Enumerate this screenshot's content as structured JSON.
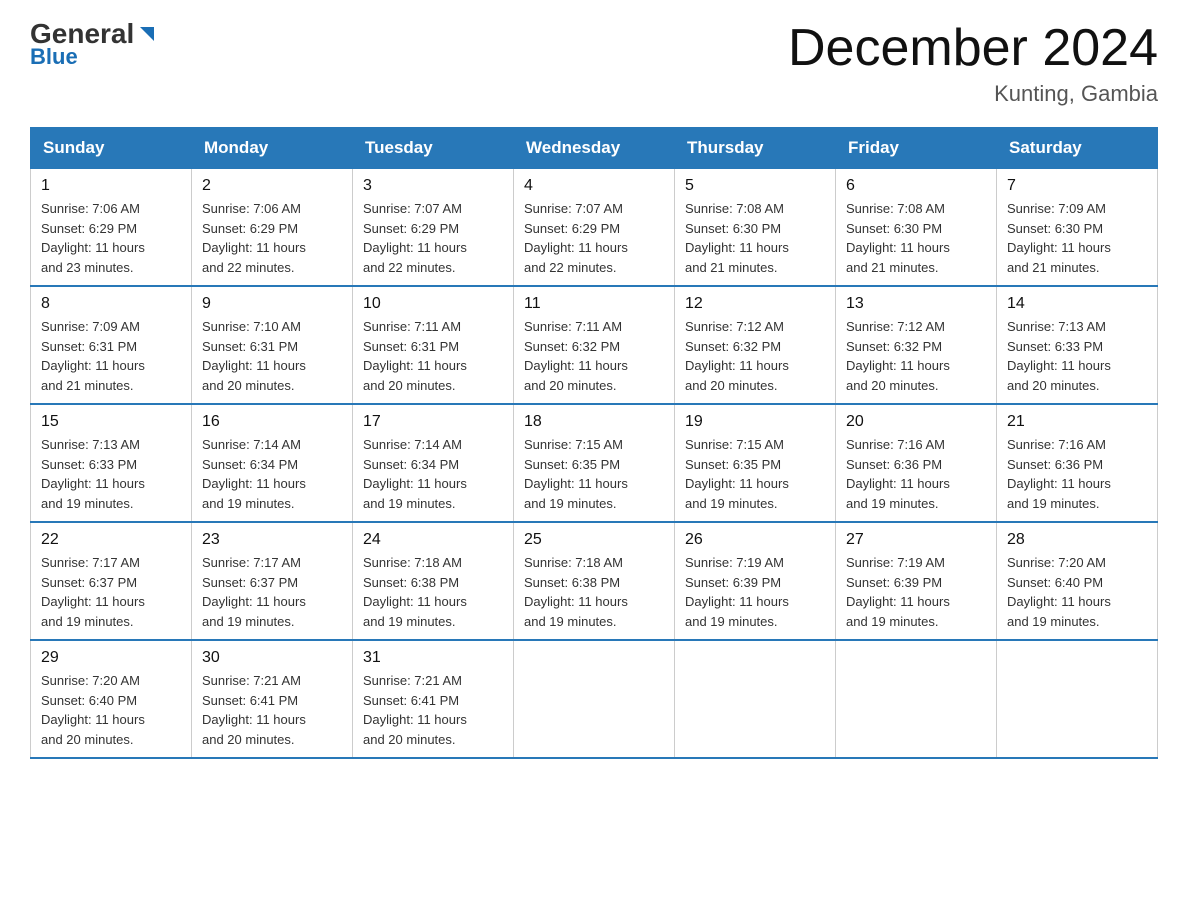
{
  "logo": {
    "text_general": "General",
    "text_blue": "Blue"
  },
  "title": "December 2024",
  "location": "Kunting, Gambia",
  "days_of_week": [
    "Sunday",
    "Monday",
    "Tuesday",
    "Wednesday",
    "Thursday",
    "Friday",
    "Saturday"
  ],
  "weeks": [
    [
      {
        "day": "1",
        "sunrise": "7:06 AM",
        "sunset": "6:29 PM",
        "daylight": "11 hours and 23 minutes."
      },
      {
        "day": "2",
        "sunrise": "7:06 AM",
        "sunset": "6:29 PM",
        "daylight": "11 hours and 22 minutes."
      },
      {
        "day": "3",
        "sunrise": "7:07 AM",
        "sunset": "6:29 PM",
        "daylight": "11 hours and 22 minutes."
      },
      {
        "day": "4",
        "sunrise": "7:07 AM",
        "sunset": "6:29 PM",
        "daylight": "11 hours and 22 minutes."
      },
      {
        "day": "5",
        "sunrise": "7:08 AM",
        "sunset": "6:30 PM",
        "daylight": "11 hours and 21 minutes."
      },
      {
        "day": "6",
        "sunrise": "7:08 AM",
        "sunset": "6:30 PM",
        "daylight": "11 hours and 21 minutes."
      },
      {
        "day": "7",
        "sunrise": "7:09 AM",
        "sunset": "6:30 PM",
        "daylight": "11 hours and 21 minutes."
      }
    ],
    [
      {
        "day": "8",
        "sunrise": "7:09 AM",
        "sunset": "6:31 PM",
        "daylight": "11 hours and 21 minutes."
      },
      {
        "day": "9",
        "sunrise": "7:10 AM",
        "sunset": "6:31 PM",
        "daylight": "11 hours and 20 minutes."
      },
      {
        "day": "10",
        "sunrise": "7:11 AM",
        "sunset": "6:31 PM",
        "daylight": "11 hours and 20 minutes."
      },
      {
        "day": "11",
        "sunrise": "7:11 AM",
        "sunset": "6:32 PM",
        "daylight": "11 hours and 20 minutes."
      },
      {
        "day": "12",
        "sunrise": "7:12 AM",
        "sunset": "6:32 PM",
        "daylight": "11 hours and 20 minutes."
      },
      {
        "day": "13",
        "sunrise": "7:12 AM",
        "sunset": "6:32 PM",
        "daylight": "11 hours and 20 minutes."
      },
      {
        "day": "14",
        "sunrise": "7:13 AM",
        "sunset": "6:33 PM",
        "daylight": "11 hours and 20 minutes."
      }
    ],
    [
      {
        "day": "15",
        "sunrise": "7:13 AM",
        "sunset": "6:33 PM",
        "daylight": "11 hours and 19 minutes."
      },
      {
        "day": "16",
        "sunrise": "7:14 AM",
        "sunset": "6:34 PM",
        "daylight": "11 hours and 19 minutes."
      },
      {
        "day": "17",
        "sunrise": "7:14 AM",
        "sunset": "6:34 PM",
        "daylight": "11 hours and 19 minutes."
      },
      {
        "day": "18",
        "sunrise": "7:15 AM",
        "sunset": "6:35 PM",
        "daylight": "11 hours and 19 minutes."
      },
      {
        "day": "19",
        "sunrise": "7:15 AM",
        "sunset": "6:35 PM",
        "daylight": "11 hours and 19 minutes."
      },
      {
        "day": "20",
        "sunrise": "7:16 AM",
        "sunset": "6:36 PM",
        "daylight": "11 hours and 19 minutes."
      },
      {
        "day": "21",
        "sunrise": "7:16 AM",
        "sunset": "6:36 PM",
        "daylight": "11 hours and 19 minutes."
      }
    ],
    [
      {
        "day": "22",
        "sunrise": "7:17 AM",
        "sunset": "6:37 PM",
        "daylight": "11 hours and 19 minutes."
      },
      {
        "day": "23",
        "sunrise": "7:17 AM",
        "sunset": "6:37 PM",
        "daylight": "11 hours and 19 minutes."
      },
      {
        "day": "24",
        "sunrise": "7:18 AM",
        "sunset": "6:38 PM",
        "daylight": "11 hours and 19 minutes."
      },
      {
        "day": "25",
        "sunrise": "7:18 AM",
        "sunset": "6:38 PM",
        "daylight": "11 hours and 19 minutes."
      },
      {
        "day": "26",
        "sunrise": "7:19 AM",
        "sunset": "6:39 PM",
        "daylight": "11 hours and 19 minutes."
      },
      {
        "day": "27",
        "sunrise": "7:19 AM",
        "sunset": "6:39 PM",
        "daylight": "11 hours and 19 minutes."
      },
      {
        "day": "28",
        "sunrise": "7:20 AM",
        "sunset": "6:40 PM",
        "daylight": "11 hours and 19 minutes."
      }
    ],
    [
      {
        "day": "29",
        "sunrise": "7:20 AM",
        "sunset": "6:40 PM",
        "daylight": "11 hours and 20 minutes."
      },
      {
        "day": "30",
        "sunrise": "7:21 AM",
        "sunset": "6:41 PM",
        "daylight": "11 hours and 20 minutes."
      },
      {
        "day": "31",
        "sunrise": "7:21 AM",
        "sunset": "6:41 PM",
        "daylight": "11 hours and 20 minutes."
      },
      null,
      null,
      null,
      null
    ]
  ],
  "labels": {
    "sunrise": "Sunrise:",
    "sunset": "Sunset:",
    "daylight": "Daylight:"
  }
}
